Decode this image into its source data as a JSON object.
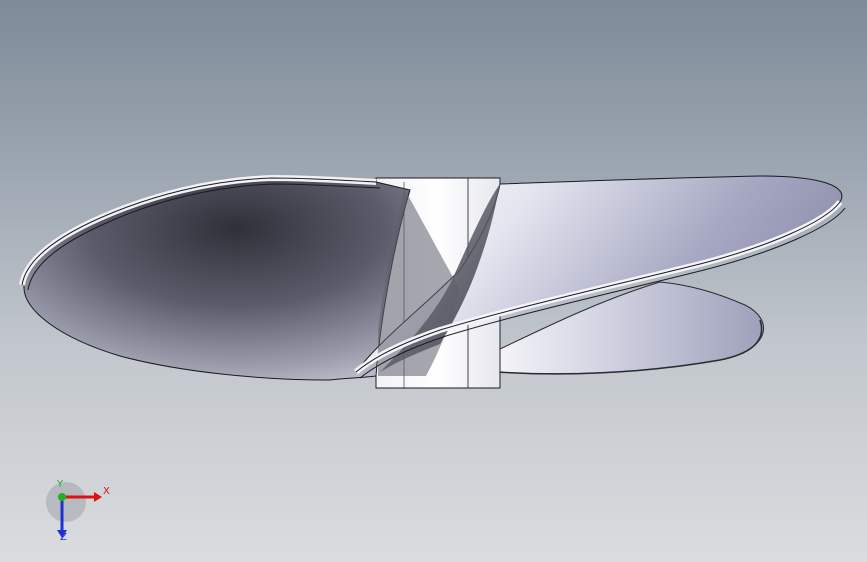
{
  "viewport": {
    "background_top": "#7e8a98",
    "background_bottom": "#dadcde"
  },
  "model": {
    "name": "propeller-model",
    "shading_colors": {
      "blade_dark": "#3e3f4a",
      "blade_mid": "#8a8c9c",
      "blade_light": "#ffffff",
      "edge": "#1a1a22",
      "hub": "#ffffff"
    }
  },
  "triad": {
    "x_label": "X",
    "y_label": "Y",
    "z_label": "Z",
    "x_color": "#e01010",
    "y_color": "#20b020",
    "z_color": "#2030d0"
  }
}
